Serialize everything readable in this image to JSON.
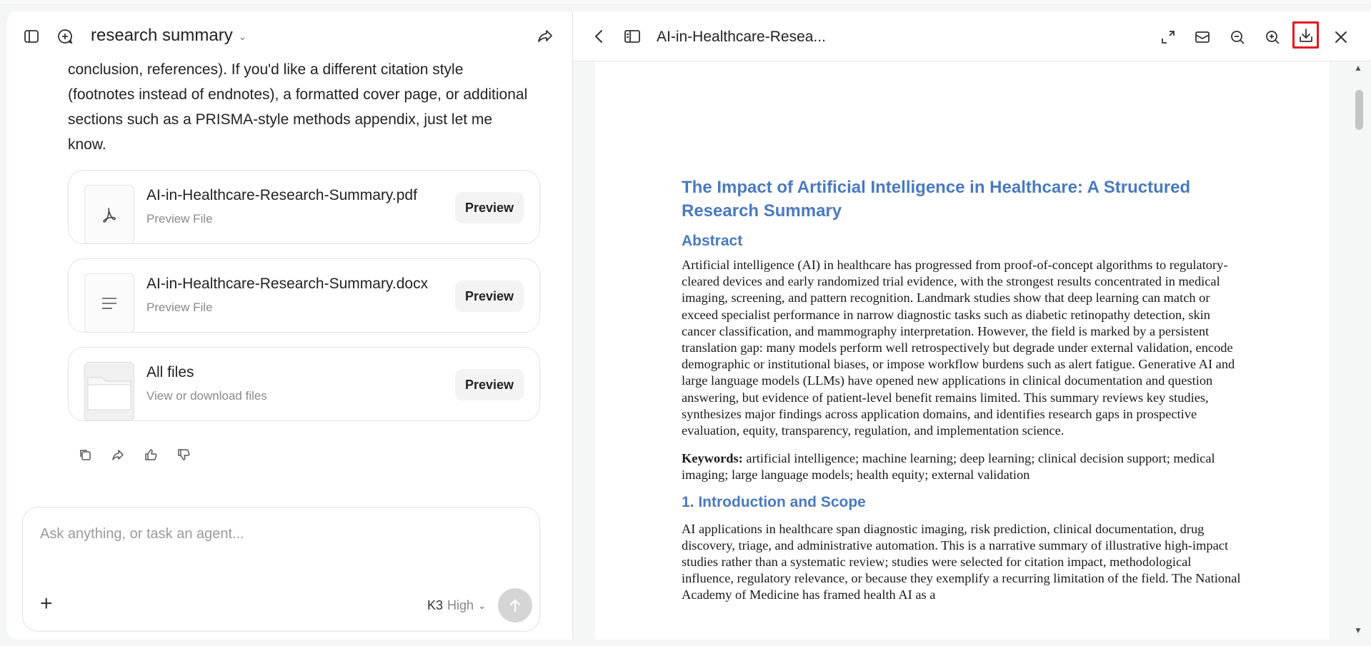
{
  "chat": {
    "title": "research summary",
    "message": "conclusion, references). If you'd like a different citation style (footnotes instead of endnotes), a formatted cover page, or additional sections such as a PRISMA-style methods appendix, just let me know.",
    "files": [
      {
        "name": "AI-in-Healthcare-Research-Summary.pdf",
        "sub": "Preview File",
        "button": "Preview",
        "icon": "pdf-icon"
      },
      {
        "name": "AI-in-Healthcare-Research-Summary.docx",
        "sub": "Preview File",
        "button": "Preview",
        "icon": "doc-lines-icon"
      },
      {
        "name": "All files",
        "sub": "View or download files",
        "button": "Preview",
        "icon": "folder-icon"
      }
    ],
    "composer": {
      "placeholder": "Ask anything, or task an agent...",
      "model": "K3",
      "mode": "High"
    }
  },
  "preview": {
    "title": "AI-in-Healthcare-Resea...",
    "highlight_color": "#e8141e",
    "doc": {
      "title": "The Impact of Artificial Intelligence in Healthcare: A Structured Research Summary",
      "abstract_heading": "Abstract",
      "abstract": "Artificial intelligence (AI) in healthcare has progressed from proof-of-concept algorithms to regulatory-cleared devices and early randomized trial evidence, with the strongest results concentrated in medical imaging, screening, and pattern recognition. Landmark studies show that deep learning can match or exceed specialist performance in narrow diagnostic tasks such as diabetic retinopathy detection, skin cancer classification, and mammography interpretation. However, the field is marked by a persistent translation gap: many models perform well retrospectively but degrade under external validation, encode demographic or institutional biases, or impose workflow burdens such as alert fatigue. Generative AI and large language models (LLMs) have opened new applications in clinical documentation and question answering, but evidence of patient-level benefit remains limited. This summary reviews key studies, synthesizes major findings across application domains, and identifies research gaps in prospective evaluation, equity, transparency, regulation, and implementation science.",
      "keywords_label": "Keywords:",
      "keywords": "artificial intelligence; machine learning; deep learning; clinical decision support; medical imaging; large language models; health equity; external validation",
      "section1_heading": "1. Introduction and Scope",
      "section1": "AI applications in healthcare span diagnostic imaging, risk prediction, clinical documentation, drug discovery, triage, and administrative automation. This is a narrative summary of illustrative high-impact studies rather than a systematic review; studies were selected for citation impact, methodological influence, regulatory relevance, or because they exemplify a recurring limitation of the field. The National Academy of Medicine has framed health AI as a"
    }
  },
  "colors": {
    "accent_heading": "#4a7abf",
    "send_disabled": "#d5d5d5"
  }
}
